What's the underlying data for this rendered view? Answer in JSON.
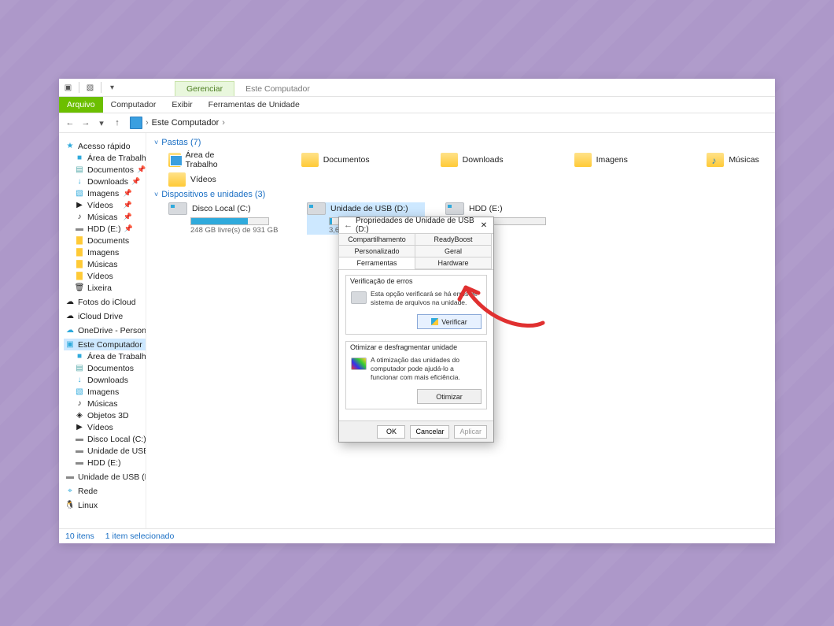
{
  "titlebar_tabs": {
    "manage": "Gerenciar",
    "context": "Este Computador"
  },
  "ribbon": {
    "file": "Arquivo",
    "computer": "Computador",
    "view": "Exibir",
    "drive_tools": "Ferramentas de Unidade"
  },
  "breadcrumb": {
    "root": "Este Computador"
  },
  "sidebar": {
    "quick": {
      "label": "Acesso rápido",
      "items": [
        "Área de Trabalho",
        "Documentos",
        "Downloads",
        "Imagens",
        "Vídeos",
        "Músicas",
        "HDD (E:)",
        "Documents",
        "Imagens",
        "Músicas",
        "Vídeos",
        "Lixeira"
      ]
    },
    "icloud_photos": "Fotos do iCloud",
    "icloud_drive": "iCloud Drive",
    "onedrive": "OneDrive - Personal",
    "this_pc": {
      "label": "Este Computador",
      "items": [
        "Área de Trabalho",
        "Documentos",
        "Downloads",
        "Imagens",
        "Músicas",
        "Objetos 3D",
        "Vídeos",
        "Disco Local (C:)",
        "Unidade de USB (D:",
        "HDD (E:)"
      ]
    },
    "usb": "Unidade de USB (D:)",
    "network": "Rede",
    "linux": "Linux"
  },
  "groups": {
    "folders": {
      "header": "Pastas (7)",
      "items": [
        "Área de Trabalho",
        "Documentos",
        "Downloads",
        "Imagens",
        "Músicas",
        "Vídeos"
      ]
    },
    "drives": {
      "header": "Dispositivos e unidades (3)",
      "items": [
        {
          "name": "Disco Local (C:)",
          "free": "248 GB livre(s) de 931 GB",
          "fill": 73
        },
        {
          "name": "Unidade de USB (D:)",
          "free": "3,62 GB livr",
          "fill": 3
        },
        {
          "name": "HDD (E:)",
          "free": "",
          "fill": 6
        }
      ]
    }
  },
  "status": {
    "count": "10 itens",
    "selected": "1 item selecionado"
  },
  "dialog": {
    "title": "Propriedades de Unidade de USB (D:)",
    "tabs": {
      "share": "Compartilhamento",
      "ready": "ReadyBoost",
      "custom": "Personalizado",
      "general": "Geral",
      "tools": "Ferramentas",
      "hw": "Hardware"
    },
    "errcheck": {
      "title": "Verificação de erros",
      "desc": "Esta opção verificará se há erros de sistema de arquivos na unidade.",
      "btn": "Verificar"
    },
    "optimize": {
      "title": "Otimizar e desfragmentar unidade",
      "desc": "A otimização das unidades do computador pode ajudá-lo a funcionar com mais eficiência.",
      "btn": "Otimizar"
    },
    "buttons": {
      "ok": "OK",
      "cancel": "Cancelar",
      "apply": "Aplicar"
    }
  }
}
